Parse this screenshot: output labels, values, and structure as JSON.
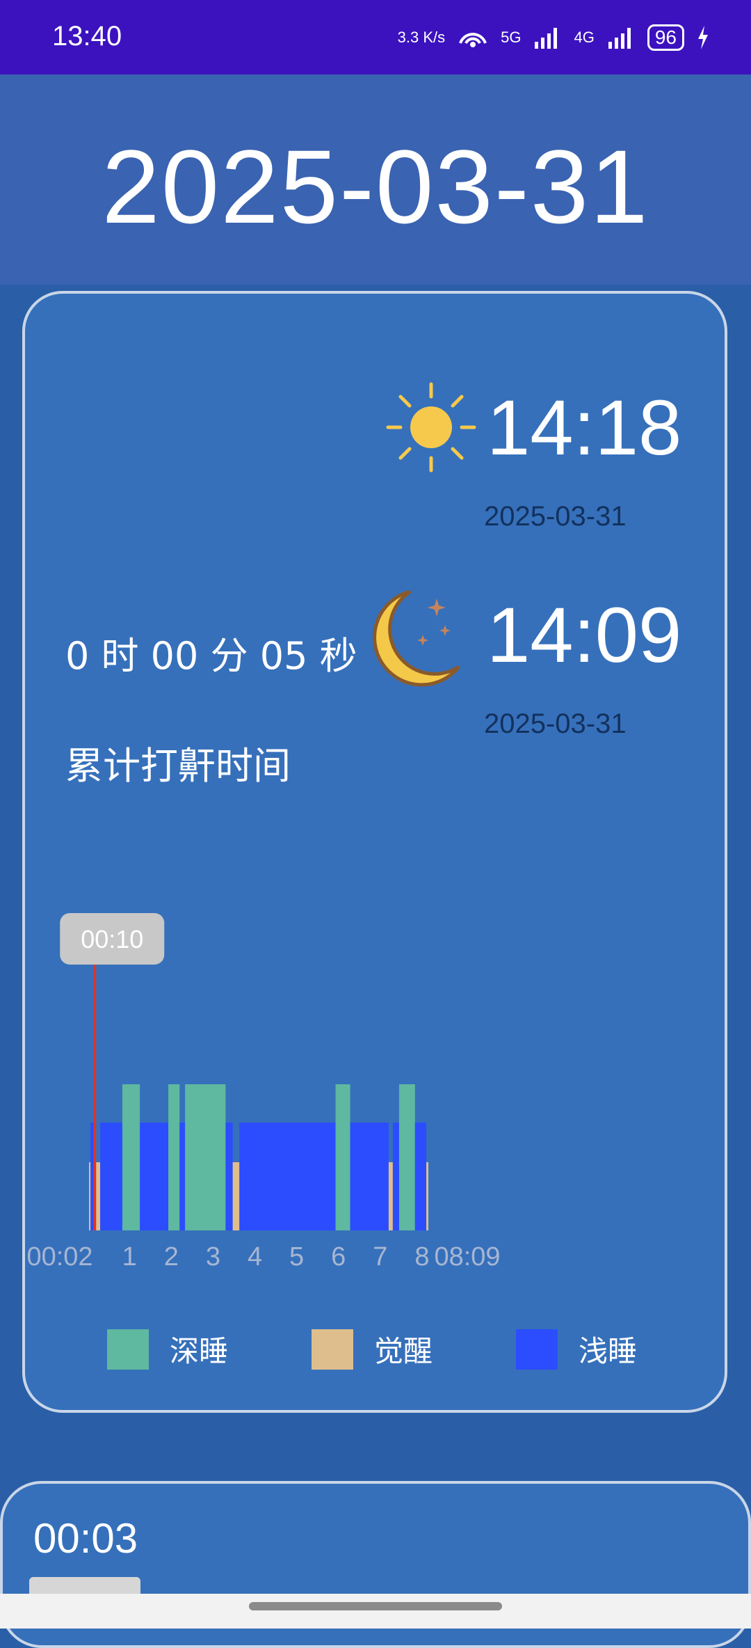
{
  "status_bar": {
    "time": "13:40",
    "net_speed": "3.3 K/s",
    "signal_5g": "5G",
    "signal_4g": "4G",
    "battery": "96",
    "icons": [
      "hotspot-icon",
      "signal-icon",
      "charging-icon"
    ]
  },
  "header": {
    "date": "2025-03-31"
  },
  "summary": {
    "wake": {
      "time": "14:18",
      "date": "2025-03-31",
      "icon": "sun-icon"
    },
    "sleep": {
      "time": "14:09",
      "date": "2025-03-31",
      "icon": "moon-icon"
    },
    "snore_duration": "0 时 00 分 05 秒",
    "snore_label": "累计打鼾时间"
  },
  "chart_data": {
    "type": "bar",
    "title": "",
    "x_start_label": "00:02",
    "x_end_label": "08:09",
    "ticks": [
      "1",
      "2",
      "3",
      "4",
      "5",
      "6",
      "7",
      "8"
    ],
    "xlim": [
      0.033,
      8.15
    ],
    "levels": {
      "深睡": 3,
      "浅睡": 2,
      "觉醒": 1
    },
    "cursor": {
      "label": "00:10",
      "x": 0.17
    },
    "segments": [
      {
        "stage": "觉醒",
        "start": 0.033,
        "end": 0.07
      },
      {
        "stage": "浅睡",
        "start": 0.07,
        "end": 0.2
      },
      {
        "stage": "觉醒",
        "start": 0.2,
        "end": 0.3
      },
      {
        "stage": "浅睡",
        "start": 0.3,
        "end": 0.83
      },
      {
        "stage": "深睡",
        "start": 0.83,
        "end": 1.25
      },
      {
        "stage": "浅睡",
        "start": 1.25,
        "end": 1.93
      },
      {
        "stage": "深睡",
        "start": 1.93,
        "end": 2.2
      },
      {
        "stage": "浅睡",
        "start": 2.2,
        "end": 2.33
      },
      {
        "stage": "深睡",
        "start": 2.33,
        "end": 3.3
      },
      {
        "stage": "浅睡",
        "start": 3.3,
        "end": 3.47
      },
      {
        "stage": "觉醒",
        "start": 3.47,
        "end": 3.63
      },
      {
        "stage": "浅睡",
        "start": 3.63,
        "end": 5.93
      },
      {
        "stage": "深睡",
        "start": 5.93,
        "end": 6.28
      },
      {
        "stage": "浅睡",
        "start": 6.28,
        "end": 7.2
      },
      {
        "stage": "觉醒",
        "start": 7.2,
        "end": 7.3
      },
      {
        "stage": "浅睡",
        "start": 7.3,
        "end": 7.45
      },
      {
        "stage": "深睡",
        "start": 7.45,
        "end": 7.83
      },
      {
        "stage": "浅睡",
        "start": 7.83,
        "end": 8.1
      },
      {
        "stage": "觉醒",
        "start": 8.1,
        "end": 8.15
      }
    ],
    "legend": [
      {
        "name": "深睡",
        "color": "#5fb8a0"
      },
      {
        "name": "觉醒",
        "color": "#dfbe8e"
      },
      {
        "name": "浅睡",
        "color": "#2b4dfd"
      }
    ]
  },
  "next_card": {
    "time": "00:03"
  }
}
